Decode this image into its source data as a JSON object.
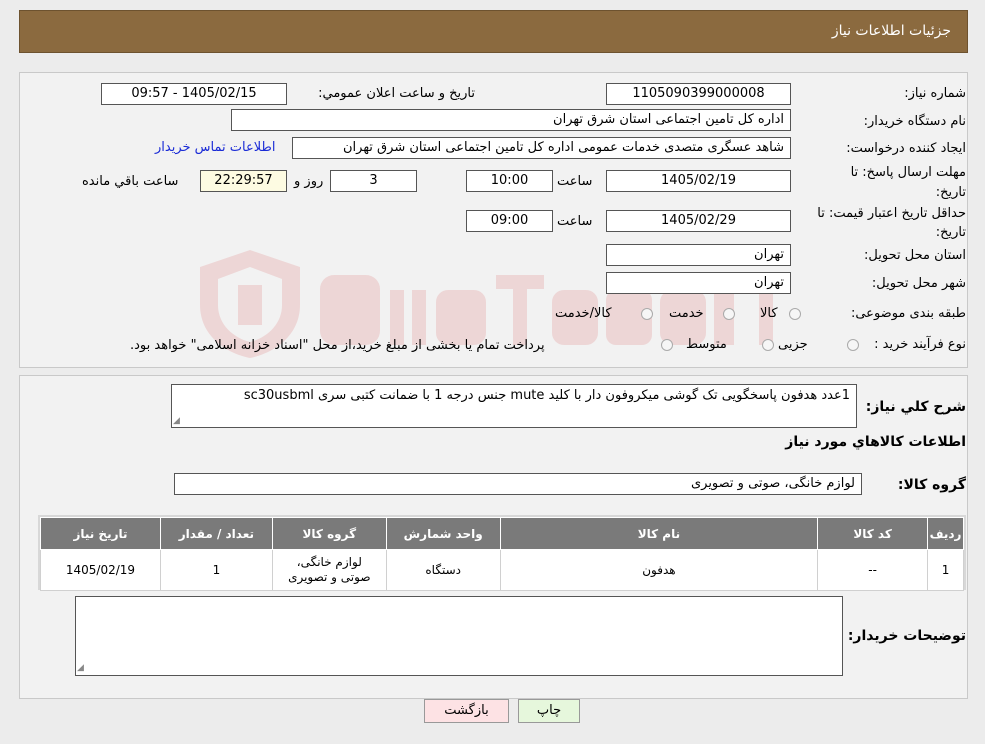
{
  "header": {
    "title": "جزئیات اطلاعات نیاز"
  },
  "form": {
    "need_number_label": "شماره نیاز:",
    "need_number": "1105090399000008",
    "announce_label": "تاريخ و ساعت اعلان عمومي:",
    "announce_value": "1405/02/15 - 09:57",
    "buyer_label": "نام دستگاه خريدار:",
    "buyer_value": "اداره کل تامین اجتماعی استان شرق تهران",
    "creator_label": "ايجاد کننده درخواست:",
    "creator_value": "شاهد عسگری متصدی خدمات عمومی اداره کل تامین اجتماعی استان شرق تهران",
    "contact_link": "اطلاعات تماس خریدار",
    "deadline_label_1": "مهلت ارسال پاسخ: تا",
    "deadline_label_2": "تاريخ:",
    "deadline_date": "1405/02/19",
    "hour_label": "ساعت",
    "deadline_time": "10:00",
    "days_value": "3",
    "days_label": "روز و",
    "remaining_value": "22:29:57",
    "remaining_label": "ساعت باقي مانده",
    "validity_label_1": "حداقل تاريخ اعتبار قيمت: تا",
    "validity_label_2": "تاريخ:",
    "validity_date": "1405/02/29",
    "validity_hour_label": "ساعت",
    "validity_time": "09:00",
    "province_label": "استان محل تحويل:",
    "province_value": "تهران",
    "city_label": "شهر محل تحويل:",
    "city_value": "تهران",
    "category_label": "طبقه بندی موضوعی:",
    "category_options": [
      "کالا",
      "خدمت",
      "کالا/خدمت"
    ],
    "process_label": "نوع فرآيند خريد :",
    "process_options": [
      "جزیی",
      "متوسط"
    ],
    "process_note": "پرداخت تمام یا بخشی از مبلغ خرید،از محل \"اسناد خزانه اسلامی\" خواهد بود."
  },
  "details": {
    "summary_label": "شرح کلي نياز:",
    "summary_text": "1عدد هدفون پاسخگویی تک گوشی میکروفون دار با کلید mute جنس درجه 1 با ضمانت کتبی سری sc30usbml",
    "items_title": "اطلاعات کالاهاي مورد نياز",
    "group_label": "گروه کالا:",
    "group_value": "لوازم خانگی، صوتی و تصویری",
    "table": {
      "headers": [
        "رديف",
        "کد کالا",
        "نام کالا",
        "واحد شمارش",
        "گروه کالا",
        "تعداد / مقدار",
        "تاريخ نياز"
      ],
      "rows": [
        [
          "1",
          "--",
          "هدفون",
          "دستگاه",
          "لوازم خانگی، صوتی و تصویری",
          "1",
          "1405/02/19"
        ]
      ]
    },
    "buyer_notes_label": "توضيحات خريدار:",
    "buyer_notes_value": ""
  },
  "buttons": {
    "print": "چاپ",
    "back": "بازگشت"
  },
  "colors": {
    "header_bg": "#8b6a3f",
    "table_header_bg": "#7a7a7a",
    "link": "#1a2bd6",
    "back_button_bg": "#fde2e4",
    "print_button_bg": "#e6f7dc"
  }
}
